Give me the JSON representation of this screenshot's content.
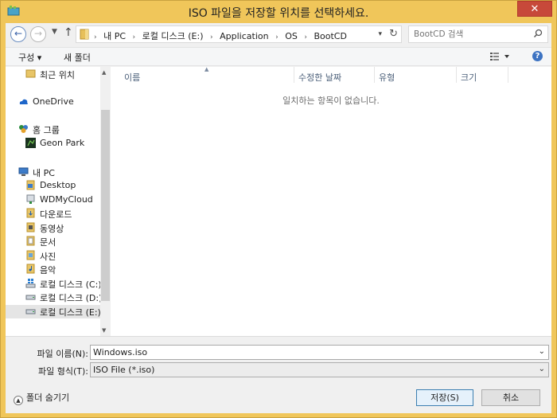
{
  "window": {
    "title": "ISO 파일을 저장할 위치를 선택하세요.",
    "close_glyph": "✕"
  },
  "address": {
    "crumbs": [
      "내 PC",
      "로컬 디스크 (E:)",
      "Application",
      "OS",
      "BootCD"
    ],
    "separator": "›",
    "search_placeholder": "BootCD 검색"
  },
  "toolbar": {
    "organize": "구성 ▾",
    "new_folder": "새 폴더",
    "help": "?"
  },
  "nav": {
    "items": [
      {
        "label": "최근 위치",
        "icon": "recent-places-icon"
      },
      {
        "label": "OneDrive",
        "icon": "onedrive-icon"
      },
      {
        "label": "홈 그룹",
        "icon": "homegroup-icon"
      },
      {
        "label": "Geon Park",
        "icon": "user-avatar-icon"
      },
      {
        "label": "내 PC",
        "icon": "this-pc-icon"
      },
      {
        "label": "Desktop",
        "icon": "desktop-folder-icon"
      },
      {
        "label": "WDMyCloud",
        "icon": "network-drive-icon"
      },
      {
        "label": "다운로드",
        "icon": "downloads-folder-icon"
      },
      {
        "label": "동영상",
        "icon": "videos-folder-icon"
      },
      {
        "label": "문서",
        "icon": "documents-folder-icon"
      },
      {
        "label": "사진",
        "icon": "pictures-folder-icon"
      },
      {
        "label": "음악",
        "icon": "music-folder-icon"
      },
      {
        "label": "로컬 디스크 (C:)",
        "icon": "system-drive-icon"
      },
      {
        "label": "로컬 디스크 (D:)",
        "icon": "hard-drive-icon"
      },
      {
        "label": "로컬 디스크 (E:)",
        "icon": "hard-drive-icon"
      }
    ],
    "selected": "로컬 디스크 (E:)"
  },
  "content": {
    "columns": [
      "이름",
      "수정한 날짜",
      "유형",
      "크기"
    ],
    "empty_message": "일치하는 항목이 없습니다."
  },
  "footer": {
    "filename_label": "파일 이름(N):",
    "filename_value": "Windows.iso",
    "filetype_label": "파일 형식(T):",
    "filetype_value": "ISO File (*.iso)",
    "hide_folders": "폴더 숨기기",
    "save_button": "저장(S)",
    "cancel_button": "취소"
  },
  "colors": {
    "title_bar": "#f0c65a",
    "close_button": "#c7493a",
    "accent": "#3c7fb1"
  }
}
